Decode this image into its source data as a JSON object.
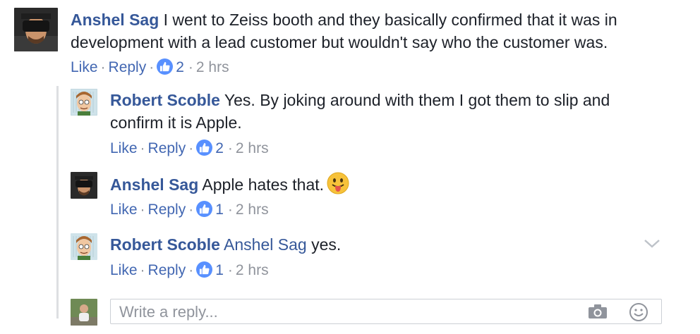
{
  "comments": [
    {
      "author": "Anshel Sag",
      "text": "I went to Zeiss booth and they basically confirmed that it was in development with a lead customer but wouldn't say who the customer was.",
      "like_label": "Like",
      "reply_label": "Reply",
      "likes": "2",
      "time": "2 hrs"
    }
  ],
  "replies": [
    {
      "author": "Robert Scoble",
      "text": "Yes. By joking around with them I got them to slip and confirm it is Apple.",
      "like_label": "Like",
      "reply_label": "Reply",
      "likes": "2",
      "time": "2 hrs"
    },
    {
      "author": "Anshel Sag",
      "text": "Apple hates that.",
      "emoji": "tongue-out-emoji",
      "like_label": "Like",
      "reply_label": "Reply",
      "likes": "1",
      "time": "2 hrs"
    },
    {
      "author": "Robert Scoble",
      "mention": "Anshel Sag",
      "text": "yes.",
      "like_label": "Like",
      "reply_label": "Reply",
      "likes": "1",
      "time": "2 hrs"
    }
  ],
  "reply_box": {
    "placeholder": "Write a reply...",
    "value": "",
    "icons": [
      "camera-icon",
      "smiley-icon"
    ]
  },
  "colors": {
    "name": "#365899",
    "link": "#4267b2",
    "muted": "#90949c",
    "like_badge": "#5890ff",
    "thread_line": "#dddfe2"
  }
}
